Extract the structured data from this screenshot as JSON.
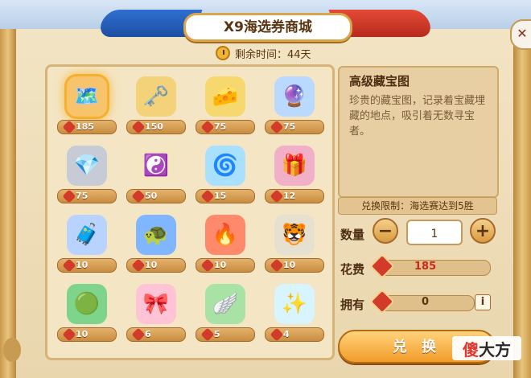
{
  "header": {
    "title": "X9海选券商城"
  },
  "timer": {
    "label": "剩余时间：44天"
  },
  "close": {
    "label": "✕"
  },
  "items": [
    {
      "name": "map",
      "emoji": "🗺️",
      "price": "185"
    },
    {
      "name": "key",
      "emoji": "🗝️",
      "price": "150"
    },
    {
      "name": "gold",
      "emoji": "🧀",
      "price": "75"
    },
    {
      "name": "orb",
      "emoji": "🔮",
      "price": "75"
    },
    {
      "name": "crystal",
      "emoji": "💎",
      "price": "75"
    },
    {
      "name": "yinyang",
      "emoji": "☯️",
      "price": "50"
    },
    {
      "name": "cloud",
      "emoji": "🌀",
      "price": "15"
    },
    {
      "name": "chest",
      "emoji": "🎁",
      "price": "12"
    },
    {
      "name": "chest2",
      "emoji": "🧳",
      "price": "10"
    },
    {
      "name": "turtle",
      "emoji": "🐢",
      "price": "10"
    },
    {
      "name": "fire",
      "emoji": "🔥",
      "price": "10"
    },
    {
      "name": "tiger",
      "emoji": "🐯",
      "price": "10"
    },
    {
      "name": "jade",
      "emoji": "🟢",
      "price": "10"
    },
    {
      "name": "box",
      "emoji": "🎀",
      "price": "6"
    },
    {
      "name": "wing",
      "emoji": "🪽",
      "price": "5"
    },
    {
      "name": "spark",
      "emoji": "✨",
      "price": "4"
    }
  ],
  "detail": {
    "title": "高级藏宝图",
    "desc": "珍贵的藏宝图，记录着宝藏埋藏的地点，吸引着无数寻宝者。",
    "limit": "兑换限制：海选赛达到5胜"
  },
  "quantity": {
    "label": "数量",
    "value": "1"
  },
  "cost": {
    "label": "花费",
    "value": "185"
  },
  "own": {
    "label": "拥有",
    "value": "0"
  },
  "exchange": {
    "label": "兑 换"
  },
  "watermark": {
    "a": "傻",
    "b": "大方"
  }
}
